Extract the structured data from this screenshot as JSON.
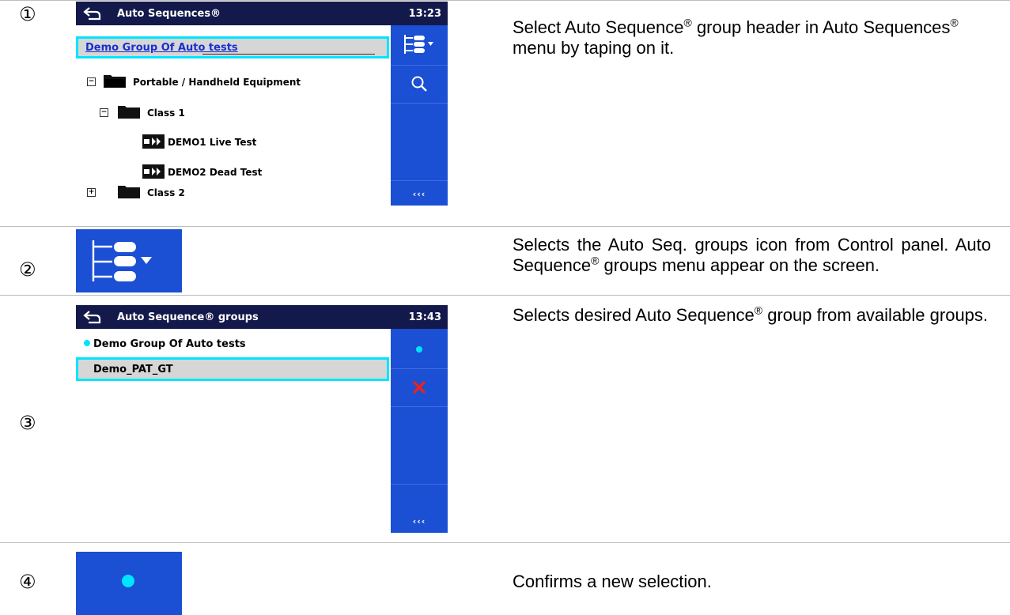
{
  "steps": [
    {
      "number": "①",
      "screen": {
        "title": "Auto Sequences®",
        "time": "13:23",
        "header": "Demo Group Of Auto tests",
        "tree": [
          {
            "label": "Portable / Handheld Equipment",
            "toggle": "−"
          },
          {
            "label": "Class 1",
            "toggle": "−"
          },
          {
            "label": "DEMO1 Live Test"
          },
          {
            "label": "DEMO2 Dead Test"
          },
          {
            "label": "Class 2",
            "toggle": "+"
          }
        ],
        "more": "‹‹‹"
      },
      "description": {
        "part1": "Select Auto Sequence",
        "reg": "®",
        "part2": " group header in Auto Sequences",
        "reg2": "®",
        "part3": " menu by taping on it."
      }
    },
    {
      "number": "②",
      "icon": "groups-menu-icon",
      "description": {
        "part1": "Selects the Auto Seq. groups icon from Control panel. Auto Sequence",
        "reg": "®",
        "part2": " groups menu appear on the screen."
      }
    },
    {
      "number": "③",
      "screen": {
        "title": "Auto Sequence® groups",
        "time": "13:43",
        "groups": [
          "Demo Group Of Auto tests",
          "Demo_PAT_GT"
        ],
        "more": "‹‹‹"
      },
      "description": {
        "part1": "Selects desired Auto Sequence",
        "reg": "®",
        "part2": " group from available groups."
      }
    },
    {
      "number": "④",
      "icon": "confirm-dot-icon",
      "description": {
        "text": "Confirms a new selection."
      }
    }
  ],
  "colors": {
    "titlebar": "#13194a",
    "panel": "#1b4fd4",
    "highlight": "#00e5ff",
    "link": "#1a2fd0",
    "delete": "#e8231a"
  }
}
